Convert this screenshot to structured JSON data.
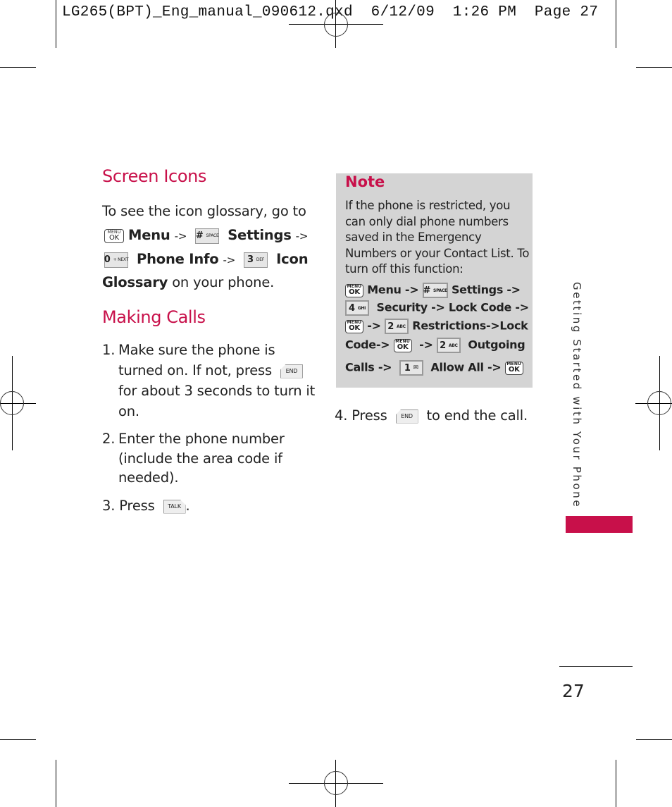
{
  "slug": {
    "text": "LG265(BPT)_Eng_manual_090612.qxd  6/12/09  1:26 PM  Page 27"
  },
  "screen_icons": {
    "title": "Screen Icons",
    "intro": "To see the icon glossary, go to",
    "path": {
      "menu_key": {
        "top": "MENU",
        "bottom": "OK"
      },
      "menu_label": "Menu",
      "arrow": "->",
      "settings_key": {
        "num": "#",
        "letters": "SPACE"
      },
      "settings_label": "Settings",
      "phone_info_key": {
        "num": "0",
        "letters": "+ NEXT"
      },
      "phone_info_label": "Phone Info",
      "icon_glossary_key": {
        "num": "3",
        "letters": "DEF"
      },
      "icon_label": "Icon",
      "glossary_label": "Glossary",
      "suffix": "on your phone."
    }
  },
  "making_calls": {
    "title": "Making Calls",
    "steps": [
      {
        "num": "1.",
        "line1": "Make sure the phone is",
        "line2a": "turned on. If not, press",
        "key": "END",
        "line3": "for about 3 seconds to turn it",
        "line4": "on."
      },
      {
        "num": "2.",
        "line1": "Enter the phone number",
        "line2": "(include the area code if",
        "line3": "needed)."
      },
      {
        "num": "3.",
        "text": "Press",
        "key": "TALK",
        "suffix": "."
      },
      {
        "num": "4.",
        "text": "Press",
        "key": "END",
        "suffix": "to end the call."
      }
    ]
  },
  "note": {
    "title": "Note",
    "text": "If the phone is restricted, you can only dial phone numbers saved in the Emergency Numbers or your Contact List. To turn off this function:",
    "keys": {
      "menu": {
        "top": "MENU",
        "bottom": "OK"
      },
      "hash": {
        "num": "#",
        "letters": "SPACE"
      },
      "four": {
        "num": "4",
        "letters": "GHI"
      },
      "two": {
        "num": "2",
        "letters": "ABC"
      },
      "one": {
        "num": "1",
        "letters": "✉"
      }
    },
    "labels": {
      "menu": "Menu",
      "arrow": "->",
      "settings": "Settings",
      "security": "Security",
      "lock_code": "Lock Code",
      "restrictions_lock": "Restrictions->Lock",
      "code": "Code->",
      "outgoing": "Outgoing",
      "calls": "Calls",
      "allow_all": "Allow All"
    }
  },
  "side_tab": {
    "text": "Getting Started with Your Phone",
    "color": "#c8104a"
  },
  "page_number": "27",
  "colors": {
    "accent": "#c8104a",
    "note_bg": "#d4d4d4"
  }
}
